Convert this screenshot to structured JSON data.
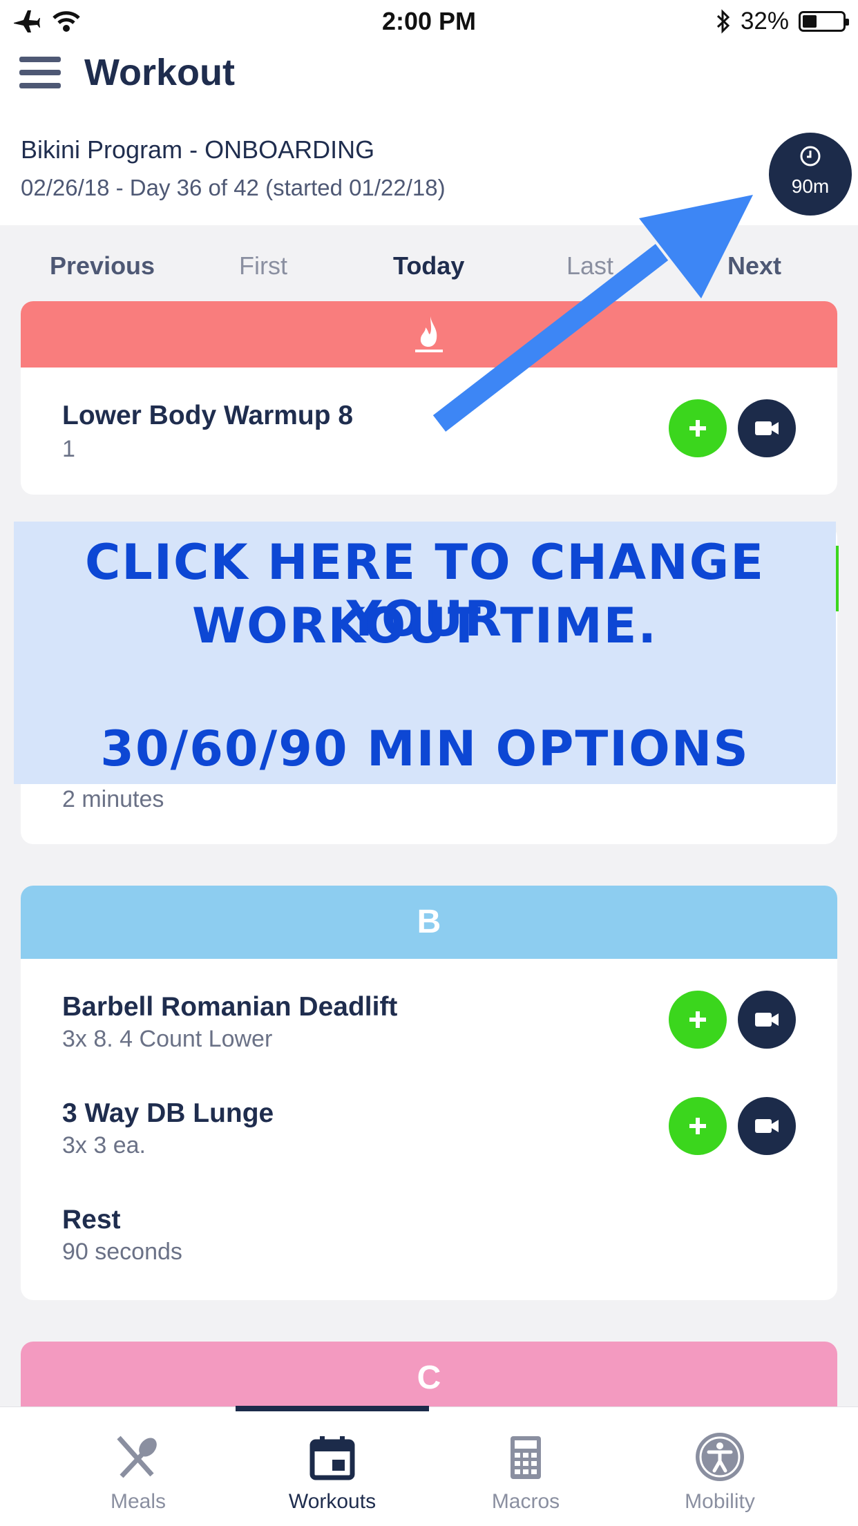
{
  "status_bar": {
    "time": "2:00 PM",
    "battery": "32%",
    "icons": [
      "airplane-icon",
      "wifi-icon",
      "bluetooth-icon",
      "battery-icon"
    ]
  },
  "header": {
    "title": "Workout",
    "program": "Bikini Program - ONBOARDING",
    "dates": "02/26/18 - Day 36 of 42 (started 01/22/18)",
    "timer_label": "90m"
  },
  "day_nav": {
    "previous": "Previous",
    "first": "First",
    "today": "Today",
    "last": "Last",
    "next": "Next"
  },
  "sections": [
    {
      "header": "",
      "icon": "flame-icon",
      "color": "#f97d7d",
      "items": [
        {
          "name": "Lower Body Warmup 8",
          "detail": "1"
        }
      ]
    },
    {
      "header": "",
      "items": [
        {
          "name": "",
          "detail": "2 minutes"
        }
      ]
    },
    {
      "header": "B",
      "color": "#8dcdf0",
      "items": [
        {
          "name": "Barbell Romanian Deadlift",
          "detail": "3x 8. 4 Count Lower"
        },
        {
          "name": "3 Way DB Lunge",
          "detail": "3x 3 ea."
        },
        {
          "name": "Rest",
          "detail": "90 seconds"
        }
      ]
    },
    {
      "header": "C",
      "color": "#f39ac0",
      "items": []
    }
  ],
  "overlay": {
    "line1": "CLICK HERE TO CHANGE YOUR",
    "line2": "WORKOUT TIME.",
    "line3": "30/60/90 MIN OPTIONS",
    "arrow_color": "#3d86f5",
    "text_color": "#0d47d4"
  },
  "tab_bar": {
    "tabs": [
      {
        "label": "Meals",
        "icon": "fork-spoon-icon"
      },
      {
        "label": "Workouts",
        "icon": "calendar-icon",
        "active": true
      },
      {
        "label": "Macros",
        "icon": "calculator-icon"
      },
      {
        "label": "Mobility",
        "icon": "accessibility-icon"
      }
    ]
  },
  "colors": {
    "navy": "#1c2b4a",
    "green": "#3bd61d",
    "background": "#f2f2f4"
  }
}
